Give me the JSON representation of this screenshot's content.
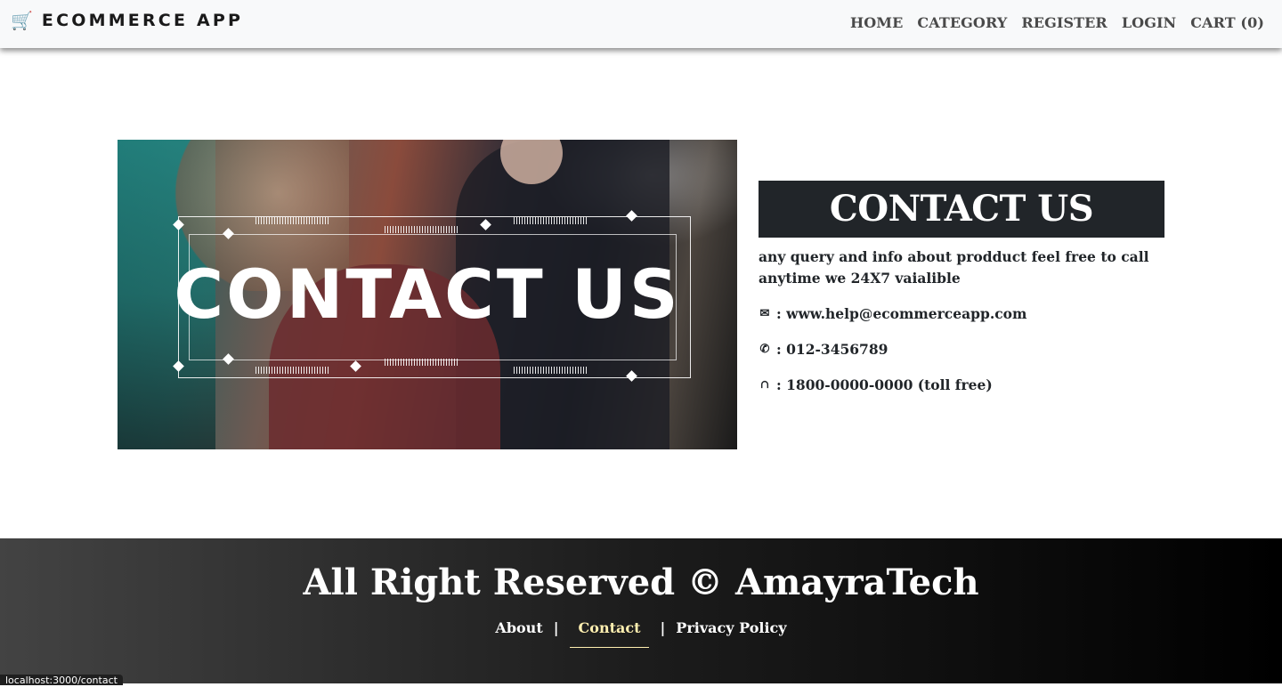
{
  "navbar": {
    "brand_icon": "🛒",
    "brand": "ECOMMERCE APP",
    "links": [
      "HOME",
      "CATEGORY",
      "REGISTER",
      "LOGIN",
      "CART (0)"
    ]
  },
  "hero": {
    "image_text": "CONTACT US"
  },
  "contact": {
    "title": "CONTACT US",
    "description": "any query and info about prodduct feel free to call anytime we 24X7 vaialible",
    "email": ": www.help@ecommerceapp.com",
    "phone": ": 012-3456789",
    "tollfree": ": 1800-0000-0000 (toll free)",
    "icons": [
      "mail-icon",
      "phone-icon",
      "headset-icon"
    ]
  },
  "footer": {
    "title": "All Right Reserved © AmayraTech",
    "links": [
      "About",
      "Contact",
      "Privacy Policy"
    ],
    "separator": "|",
    "active_link": "Contact",
    "active_color": "#ffefb0"
  },
  "status_url": "localhost:3000/contact"
}
